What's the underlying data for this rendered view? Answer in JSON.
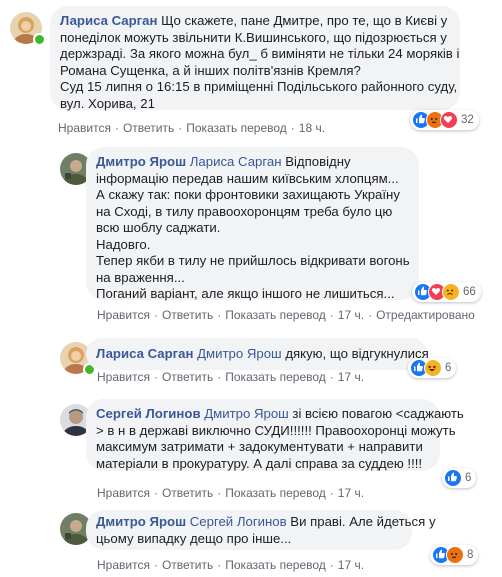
{
  "comments": [
    {
      "author": "Лариса Сарган",
      "text_lines": [
        "Що скажете, пане Дмитре, про те, що в Києві у",
        "понеділок можуть звільнити К.Вишинського, що підозрюється у",
        "держзраді. За якого можна бул_ б виміняти не тільки 24 моряків і",
        "Романа Сущенка, а й інших політв'язнів Кремля?",
        "Суд 15 липня о 16:15 в приміщенні Подільського районного суду,",
        "вул. Хорива, 21"
      ],
      "actions": [
        "Нравится",
        "Ответить",
        "Показать перевод",
        "18 ч."
      ],
      "reactions": [
        "like",
        "angry",
        "love"
      ],
      "reaction_count": "32"
    },
    {
      "author": "Дмитро Ярош",
      "mention": "Лариса Сарган",
      "text_lines": [
        "Відповідну",
        "інформацію передав нашим київським хлопцям...",
        "А скажу так: поки фронтовики захищають Україну",
        "на Сході, в тилу правоохоронцям треба було цю",
        "всю шоблу саджати.",
        "Надовго.",
        "Тепер якби в тилу не прийшлось відкривати вогонь",
        "на враження...",
        "Поганий варіант, але якщо іншого не лишиться..."
      ],
      "actions": [
        "Нравится",
        "Ответить",
        "Показать перевод",
        "17 ч.",
        "Отредактировано"
      ],
      "reactions": [
        "like",
        "love",
        "sad"
      ],
      "reaction_count": "66"
    },
    {
      "author": "Лариса Сарган",
      "mention": "Дмитро Ярош",
      "text_lines": [
        "дякую, що відгукнулися"
      ],
      "actions": [
        "Нравится",
        "Ответить",
        "Показать перевод",
        "17 ч."
      ],
      "reactions": [
        "like",
        "haha"
      ],
      "reaction_count": "6"
    },
    {
      "author": "Сергей Логинов",
      "mention": "Дмитро Ярош",
      "text_lines": [
        "зі всією повагою <саджають",
        "> в н в державі виключно СУДИ!!!!!! Правоохоронці можуть",
        "максимум затримати + задокументувати + направити",
        "матеріали в прокуратуру. А далі справа за суддею !!!!"
      ],
      "actions": [
        "Нравится",
        "Ответить",
        "Показать перевод",
        "17 ч."
      ],
      "reactions": [
        "like"
      ],
      "reaction_count": "6"
    },
    {
      "author": "Дмитро Ярош",
      "mention": "Сергей Логинов",
      "text_lines": [
        "Ви праві. Але йдеться у",
        "цьому випадку дещо про інше..."
      ],
      "actions": [
        "Нравится",
        "Ответить",
        "Показать перевод",
        "17 ч."
      ],
      "reactions": [
        "like",
        "angry"
      ],
      "reaction_count": "8"
    }
  ],
  "colors": {
    "link": "#385898",
    "bubble": "#f2f3f5",
    "like": "#1877f2",
    "angry": "#e9710f",
    "love": "#f33e58",
    "online": "#42b72a"
  }
}
